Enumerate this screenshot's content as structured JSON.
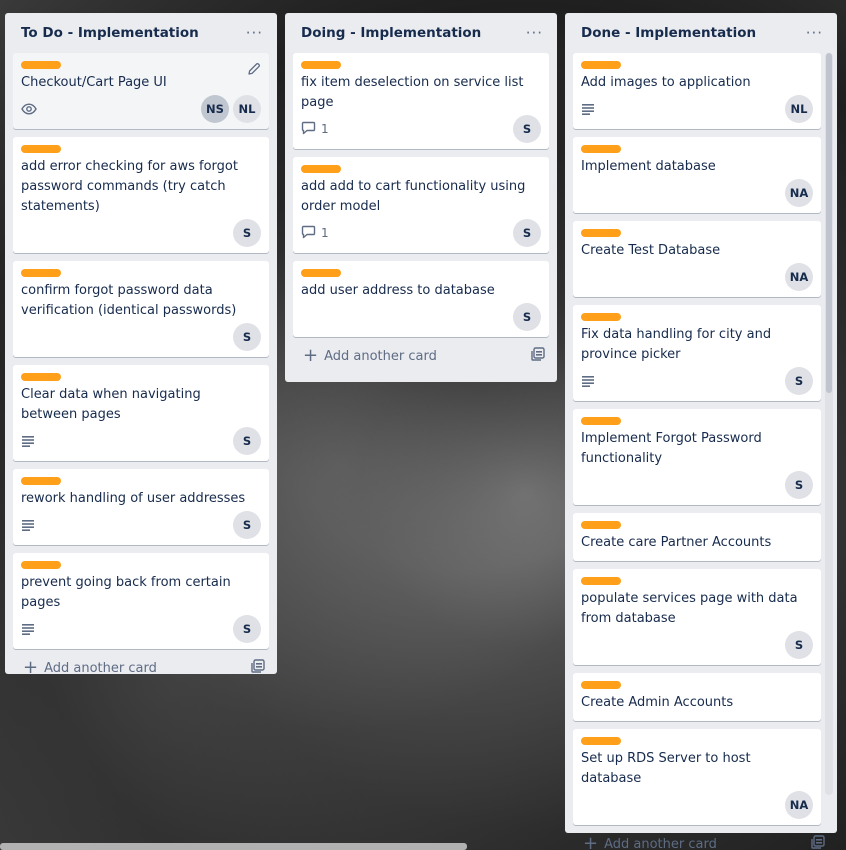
{
  "lists": [
    {
      "title": "To Do - Implementation",
      "add_card_label": "Add another card",
      "cards": [
        {
          "title": "Checkout/Cart Page UI",
          "watch": true,
          "members": [
            "NS",
            "NL"
          ],
          "hovered": true
        },
        {
          "title": "add error checking for aws forgot password commands (try catch statements)",
          "members": [
            "S"
          ]
        },
        {
          "title": "confirm forgot password data verification (identical passwords)",
          "members": [
            "S"
          ]
        },
        {
          "title": "Clear data when navigating between pages",
          "description": true,
          "members": [
            "S"
          ]
        },
        {
          "title": "rework handling of user addresses",
          "description": true,
          "members": [
            "S"
          ]
        },
        {
          "title": "prevent going back from certain pages",
          "description": true,
          "members": [
            "S"
          ]
        }
      ]
    },
    {
      "title": "Doing - Implementation",
      "add_card_label": "Add another card",
      "cards": [
        {
          "title": "fix item deselection on service list page",
          "comments": "1",
          "members": [
            "S"
          ]
        },
        {
          "title": "add add to cart functionality using order model",
          "comments": "1",
          "members": [
            "S"
          ]
        },
        {
          "title": "add user address to database",
          "members": [
            "S"
          ]
        }
      ]
    },
    {
      "title": "Done - Implementation",
      "add_card_label": "Add another card",
      "cards": [
        {
          "title": "Add images to application",
          "description": true,
          "members": [
            "NL"
          ]
        },
        {
          "title": "Implement database",
          "members": [
            "NA"
          ]
        },
        {
          "title": "Create Test Database",
          "members": [
            "NA"
          ]
        },
        {
          "title": "Fix data handling for city and province picker",
          "description": true,
          "members": [
            "S"
          ]
        },
        {
          "title": "Implement Forgot Password functionality",
          "members": [
            "S"
          ]
        },
        {
          "title": "Create care Partner Accounts",
          "members": []
        },
        {
          "title": "populate services page with data from database",
          "members": [
            "S"
          ]
        },
        {
          "title": "Create Admin Accounts",
          "members": []
        },
        {
          "title": "Set up RDS Server to host database",
          "members": [
            "NA"
          ]
        }
      ]
    }
  ],
  "colors": {
    "label": "#ff9f1a",
    "list_bg": "#ebecf0",
    "text": "#172b4d",
    "muted": "#5e6c84"
  },
  "icons": {
    "menu": "more-icon",
    "watch": "eye-icon",
    "description": "description-icon",
    "comment": "comment-icon",
    "plus": "plus-icon",
    "template": "card-template-icon",
    "edit": "pencil-icon"
  }
}
